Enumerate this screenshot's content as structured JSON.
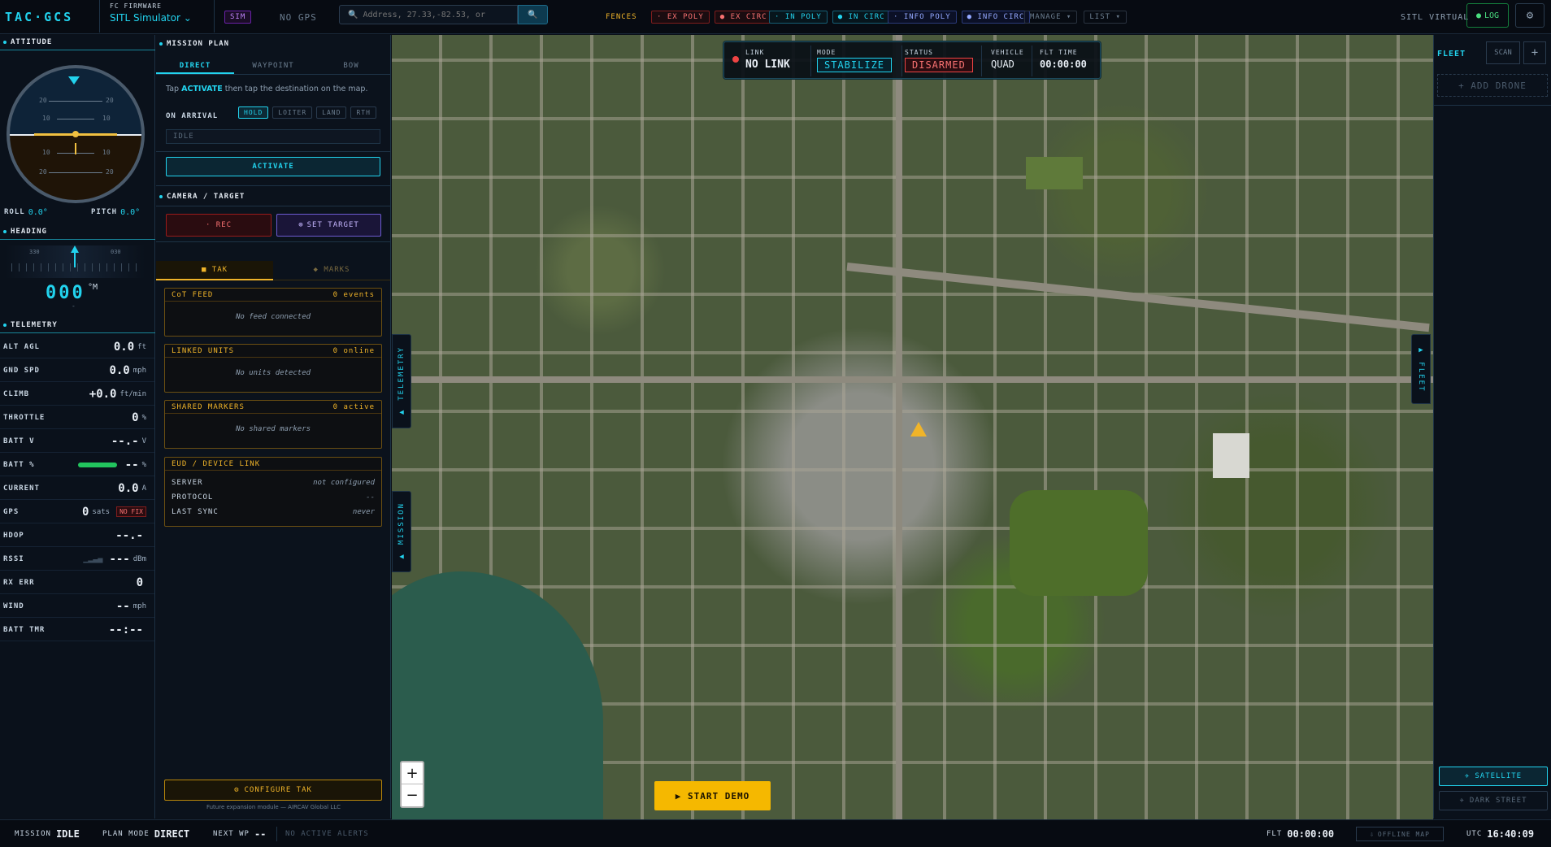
{
  "app": {
    "title": "TAC·GCS"
  },
  "topbar": {
    "fc_label": "FC FIRMWARE",
    "fc_value": "SITL Simulator",
    "sim_badge": "SIM",
    "gps_status": "NO GPS",
    "search_placeholder": "Address, 27.33,-82.53, or",
    "fences_label": "FENCES",
    "fence_buttons": [
      "EX POLY",
      "EX CIRC",
      "IN POLY",
      "IN CIRC",
      "INFO POLY",
      "INFO CIRC"
    ],
    "manage_label": "MANAGE ▾",
    "list_label": "LIST ▾",
    "sitl_label": "SITL VIRTUAL",
    "log_label": "LOG"
  },
  "attitude": {
    "title": "ATTITUDE",
    "scale": [
      "20",
      "10",
      "10",
      "20"
    ],
    "roll_label": "ROLL",
    "roll_value": "0.0°",
    "pitch_label": "PITCH",
    "pitch_value": "0.0°"
  },
  "heading": {
    "title": "HEADING",
    "left_tick": "330",
    "right_tick": "030",
    "value": "000",
    "unit": "°M",
    "sub": "-"
  },
  "telemetry": {
    "title": "TELEMETRY",
    "rows": [
      {
        "k": "ALT AGL",
        "v": "0.0",
        "u": "ft"
      },
      {
        "k": "GND SPD",
        "v": "0.0",
        "u": "mph"
      },
      {
        "k": "CLIMB",
        "v": "+0.0",
        "u": "ft/min"
      },
      {
        "k": "THROTTLE",
        "v": "0",
        "u": "%"
      },
      {
        "k": "BATT V",
        "v": "--.-",
        "u": "V"
      },
      {
        "k": "BATT %",
        "v": "--",
        "u": "%"
      },
      {
        "k": "CURRENT",
        "v": "0.0",
        "u": "A"
      },
      {
        "k": "GPS",
        "v": "0",
        "u": "sats"
      },
      {
        "k": "HDOP",
        "v": "--.-",
        "u": ""
      },
      {
        "k": "RSSI",
        "v": "---",
        "u": "dBm"
      },
      {
        "k": "RX ERR",
        "v": "0",
        "u": ""
      },
      {
        "k": "WIND",
        "v": "--",
        "u": "mph"
      },
      {
        "k": "BATT TMR",
        "v": "--:--",
        "u": ""
      }
    ],
    "gps_fix": "NO FIX",
    "colors": {
      "battery_bar": "#22c55e"
    }
  },
  "mission": {
    "title": "MISSION PLAN",
    "tabs": [
      "DIRECT",
      "WAYPOINT",
      "BOW"
    ],
    "hint_pre": "Tap",
    "hint_key": "ACTIVATE",
    "hint_post": "then tap the destination on the map.",
    "on_arrival_label": "ON ARRIVAL",
    "arrival_options": [
      "HOLD",
      "LOITER",
      "LAND",
      "RTH"
    ],
    "status": "IDLE",
    "activate": "ACTIVATE"
  },
  "camera": {
    "title": "CAMERA / TARGET",
    "rec": "· REC",
    "set_target": "SET TARGET"
  },
  "tak": {
    "tabs": [
      "TAK",
      "MARKS"
    ],
    "cards": [
      {
        "title": "CoT FEED",
        "count": "0 events",
        "body": "No feed connected"
      },
      {
        "title": "LINKED UNITS",
        "count": "0 online",
        "body": "No units detected"
      },
      {
        "title": "SHARED MARKERS",
        "count": "0 active",
        "body": "No shared markers"
      }
    ],
    "eud": {
      "title": "EUD / DEVICE LINK",
      "rows": [
        {
          "k": "SERVER",
          "v": "not configured"
        },
        {
          "k": "PROTOCOL",
          "v": "--"
        },
        {
          "k": "LAST SYNC",
          "v": "never"
        }
      ]
    },
    "configure": "CONFIGURE TAK",
    "footer": "Future expansion module — AIRCAV Global LLC"
  },
  "status_bar": {
    "link_label": "LINK",
    "link_value": "NO LINK",
    "mode_label": "MODE",
    "mode_value": "STABILIZE",
    "status_label": "STATUS",
    "status_value": "DISARMED",
    "vehicle_label": "VEHICLE",
    "vehicle_value": "QUAD",
    "flt_label": "FLT TIME",
    "flt_value": "00:00:00"
  },
  "map": {
    "side_telemetry": "▶ TELEMETRY",
    "side_mission": "▶ MISSION",
    "side_fleet": "▶ FLEET",
    "zoom_in": "+",
    "zoom_out": "−",
    "start_demo": "▶ START DEMO"
  },
  "fleet": {
    "title": "FLEET",
    "scan": "SCAN",
    "add": "+",
    "add_drone": "+ ADD DRONE",
    "satellite": "SATELLITE",
    "dark_street": "DARK STREET"
  },
  "bottom": {
    "mission_label": "MISSION",
    "mission_value": "IDLE",
    "plan_mode_label": "PLAN MODE",
    "plan_mode_value": "DIRECT",
    "next_wp_label": "NEXT WP",
    "next_wp_value": "--",
    "alerts": "NO ACTIVE ALERTS",
    "flt_label": "FLT",
    "flt_value": "00:00:00",
    "offline_map": "OFFLINE MAP",
    "utc_label": "UTC",
    "utc_value": "16:40:09"
  }
}
